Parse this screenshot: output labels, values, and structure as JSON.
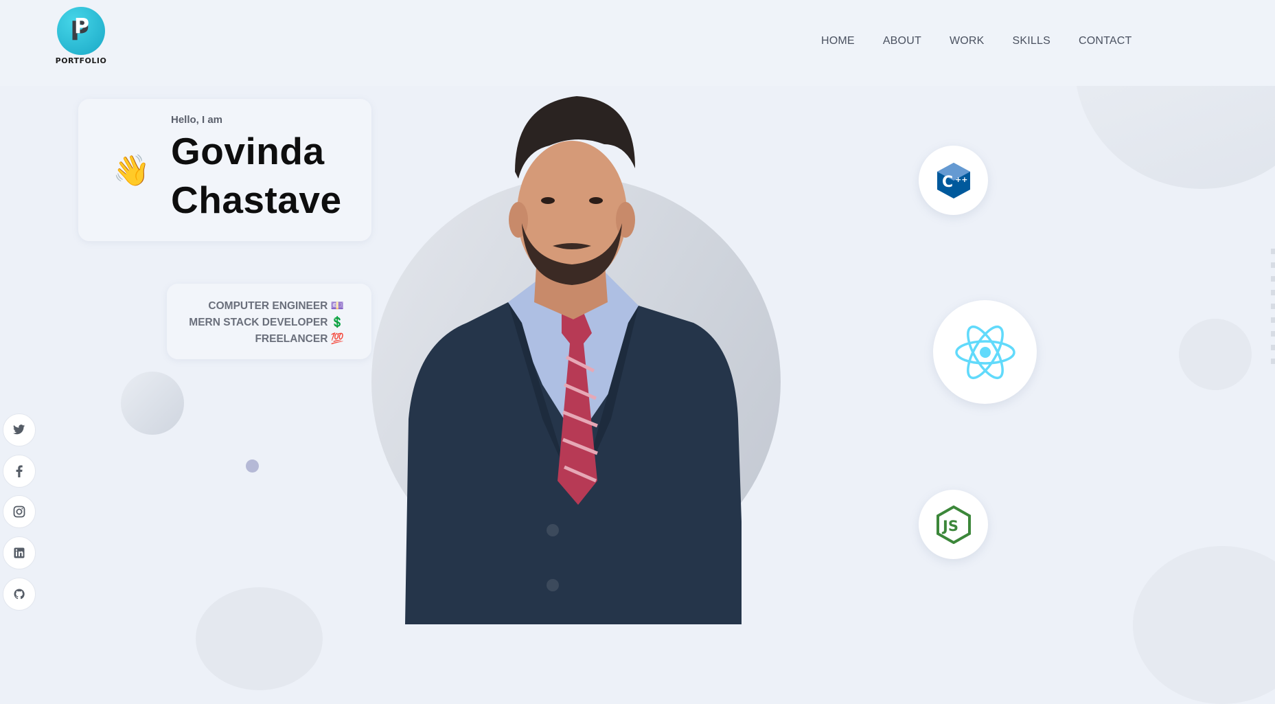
{
  "logo": {
    "text": "PORTFOLIO",
    "icon": "portfolio-logo-icon"
  },
  "nav": {
    "items": [
      "HOME",
      "ABOUT",
      "WORK",
      "SKILLS",
      "CONTACT"
    ]
  },
  "hero": {
    "greeting": "Hello, I am",
    "name_line1": "Govinda",
    "name_line2": "Chastave",
    "wave_icon": "waving-hand-icon",
    "roles": [
      "COMPUTER ENGINEER 💷",
      "MERN STACK DEVELOPER 💲",
      "FREELANCER 💯"
    ]
  },
  "tech_icons": [
    "cpp-icon",
    "react-icon",
    "nodejs-icon"
  ],
  "social": [
    "twitter-icon",
    "facebook-icon",
    "instagram-icon",
    "linkedin-icon",
    "github-icon"
  ],
  "colors": {
    "accent": "#1aa8c6",
    "background": "#edf1f8",
    "react": "#61dafb",
    "cpp": "#00599c",
    "node": "#3c873a"
  }
}
